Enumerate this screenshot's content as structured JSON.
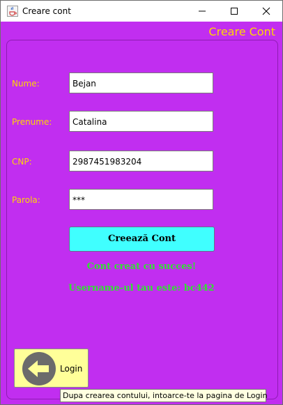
{
  "window": {
    "title": "Creare cont",
    "icon": "java-coffee-icon"
  },
  "header": {
    "title": "Creare Cont"
  },
  "form": {
    "nume": {
      "label": "Nume:",
      "value": "Bejan"
    },
    "prenume": {
      "label": "Prenume:",
      "value": "Catalina"
    },
    "cnp": {
      "label": "CNP:",
      "value": "2987451983204"
    },
    "parola": {
      "label": "Parola:",
      "value": "***"
    }
  },
  "create_button": {
    "label": "Creează Cont"
  },
  "messages": {
    "success": "Cont creat cu succes!",
    "username": "Username-ul tau este: bc442"
  },
  "login_button": {
    "label": "Login",
    "icon": "arrow-left-icon"
  },
  "tooltip": {
    "text": "Dupa crearea contului, intoarce-te la pagina de Login"
  },
  "colors": {
    "background": "#c12ef0",
    "label": "#ffd700",
    "create_button": "#40ffff",
    "success": "#32e032",
    "login_button": "#ffff99"
  }
}
